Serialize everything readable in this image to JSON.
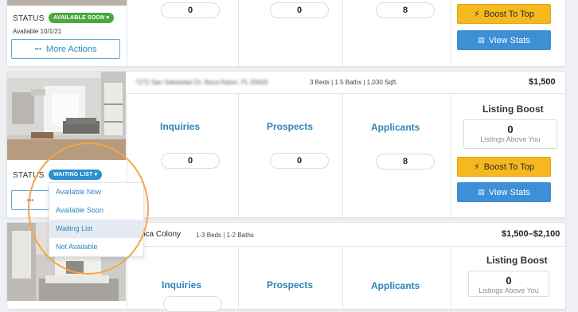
{
  "listing1": {
    "status_label": "STATUS",
    "status_badge": "AVAILABLE SOON",
    "available_date": "Available 10/1/21",
    "more_actions": "More Actions",
    "inquiries_count": "0",
    "prospects_count": "0",
    "applicants_count": "8",
    "boost_button": "Boost To Top",
    "stats_button": "View Stats"
  },
  "listing2": {
    "address": "7272 San Sebastian Dr, Boca Raton, FL 33433",
    "details": "3 Beds | 1.5 Baths | 1,030 Sqft.",
    "price": "$1,500",
    "inquiries_label": "Inquiries",
    "prospects_label": "Prospects",
    "applicants_label": "Applicants",
    "inquiries_count": "0",
    "prospects_count": "0",
    "applicants_count": "8",
    "boost_title": "Listing Boost",
    "boost_count": "0",
    "boost_sub": "Listings Above You",
    "boost_button": "Boost To Top",
    "stats_button": "View Stats",
    "status_label": "STATUS",
    "status_badge": "WAITING LIST"
  },
  "status_menu": {
    "options": [
      "Available Now",
      "Available Soon",
      "Waiting List",
      "Not Available"
    ],
    "selected": "Waiting List"
  },
  "listing3": {
    "title": "oca Colony",
    "details": "1-3 Beds | 1-2 Baths",
    "price": "$1,500–$2,100",
    "inquiries_label": "Inquiries",
    "prospects_label": "Prospects",
    "applicants_label": "Applicants",
    "boost_title": "Listing Boost",
    "boost_count": "0",
    "boost_sub": "Listings Above You"
  },
  "colors": {
    "available_soon": "#4aa83c",
    "waiting_list": "#2b8fd0",
    "boost": "#f6b81f",
    "stats": "#3d8fd6",
    "highlight": "#f5a547"
  }
}
